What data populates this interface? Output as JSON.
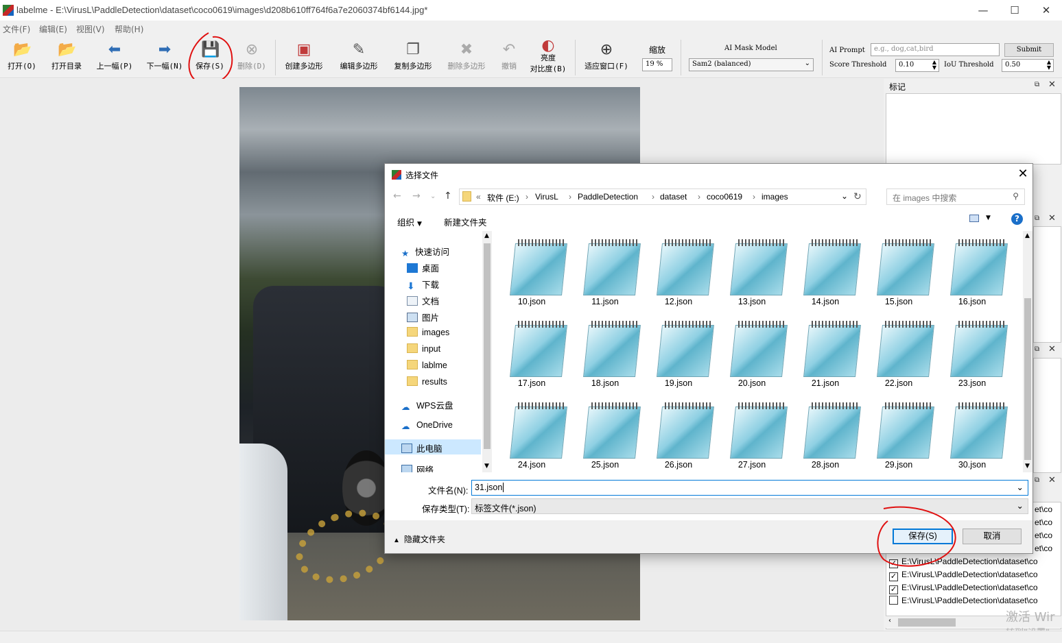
{
  "window": {
    "title": "labelme - E:\\VirusL\\PaddleDetection\\dataset\\coco0619\\images\\d208b610ff764f6a7e2060374bf6144.jpg*",
    "minimize": "—",
    "maximize": "☐",
    "close": "✕"
  },
  "menu": [
    "文件(F)",
    "编辑(E)",
    "视图(V)",
    "帮助(H)"
  ],
  "toolbar": {
    "open": "打开(O)",
    "open_dir": "打开目录",
    "prev": "上一幅(P)",
    "next": "下一幅(N)",
    "save": "保存(S)",
    "delete": "删除(D)",
    "create_polygon": "创建多边形",
    "edit_polygon": "编辑多边形",
    "copy_polygon": "复制多边形",
    "delete_polygon": "删除多边形",
    "undo": "撤销",
    "brightness_line1": "亮度",
    "brightness_line2": "对比度(B)",
    "fit_window": "适应窗口(F)",
    "zoom_label": "缩放",
    "zoom_value": "19 %",
    "ai_mask_label": "AI Mask Model",
    "ai_mask_value": "Sam2 (balanced)",
    "ai_prompt_label": "AI Prompt",
    "ai_prompt_placeholder": "e.g., dog,cat,bird",
    "submit": "Submit",
    "score_label": "Score Threshold",
    "score_value": "0.10",
    "iou_label": "IoU Threshold",
    "iou_value": "0.50"
  },
  "dock": {
    "labels_title": "标记",
    "file_list": [
      {
        "path": "E:\\VirusL\\PaddleDetection\\dataset\\co",
        "checked": true
      },
      {
        "path": "E:\\VirusL\\PaddleDetection\\dataset\\co",
        "checked": true
      },
      {
        "path": "E:\\VirusL\\PaddleDetection\\dataset\\co",
        "checked": true
      },
      {
        "path": "E:\\VirusL\\PaddleDetection\\dataset\\co",
        "checked": false
      }
    ],
    "partial_rows": [
      "et\\co",
      "et\\co",
      "et\\co",
      "et\\co"
    ]
  },
  "watermark": {
    "line1": "激活 Wir",
    "line2": "转到\"设置\""
  },
  "dialog": {
    "title": "选择文件",
    "path": [
      "«",
      "软件 (E:)",
      "VirusL",
      "PaddleDetection",
      "dataset",
      "coco0619",
      "images"
    ],
    "search_placeholder": "在 images 中搜索",
    "organize": "组织",
    "new_folder": "新建文件夹",
    "nav": {
      "quick_access": "快速访问",
      "desktop": "桌面",
      "downloads": "下载",
      "documents": "文档",
      "pictures": "图片",
      "images": "images",
      "input": "input",
      "lablme": "lablme",
      "results": "results",
      "wps": "WPS云盘",
      "onedrive": "OneDrive",
      "this_pc": "此电脑",
      "network": "网络"
    },
    "files": [
      "10.json",
      "11.json",
      "12.json",
      "13.json",
      "14.json",
      "15.json",
      "16.json",
      "17.json",
      "18.json",
      "19.json",
      "20.json",
      "21.json",
      "22.json",
      "23.json",
      "24.json",
      "25.json",
      "26.json",
      "27.json",
      "28.json",
      "29.json",
      "30.json"
    ],
    "filename_label": "文件名(N):",
    "filename_value": "31.json",
    "filetype_label": "保存类型(T):",
    "filetype_value": "标签文件(*.json)",
    "hide_folders": "隐藏文件夹",
    "save": "保存(S)",
    "cancel": "取消"
  }
}
